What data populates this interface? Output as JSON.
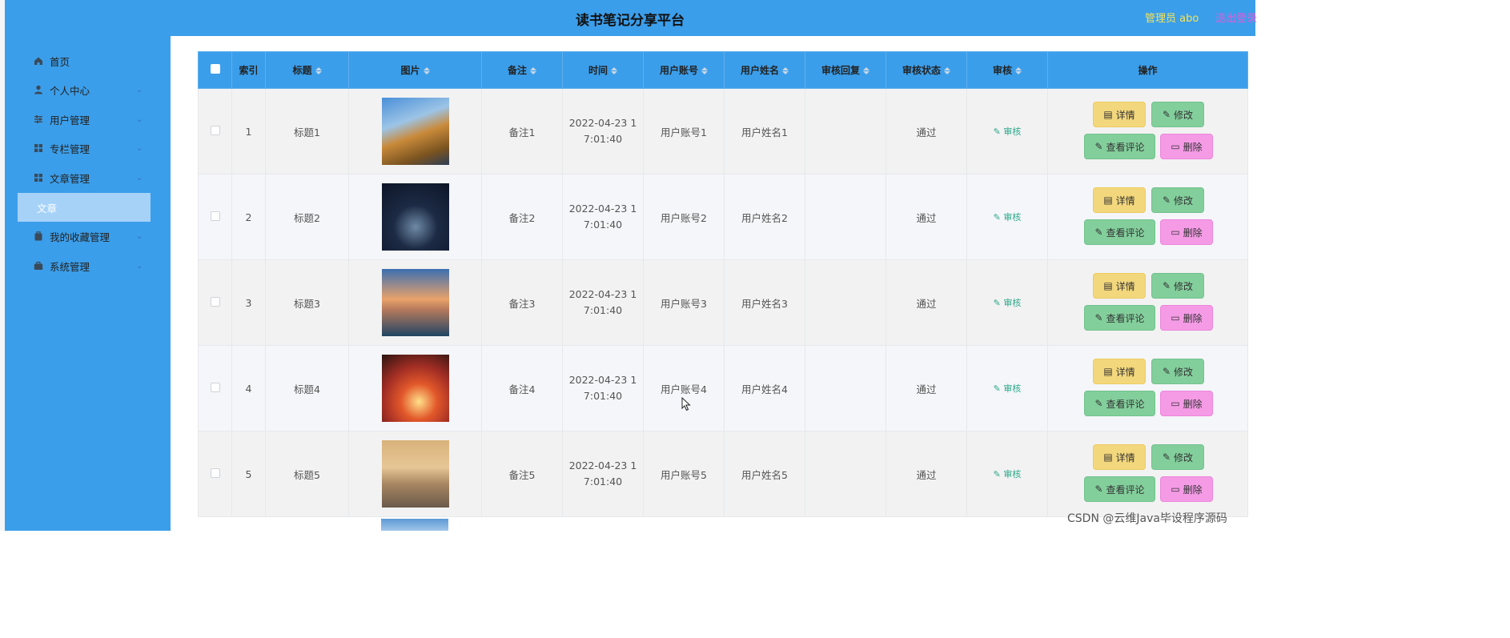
{
  "header": {
    "title": "读书笔记分享平台",
    "admin": "管理员 abo",
    "logout": "退出登录"
  },
  "sidebar": {
    "items": [
      {
        "label": "首页",
        "icon": "home-icon",
        "chevron": false
      },
      {
        "label": "个人中心",
        "icon": "user-icon",
        "chevron": true
      },
      {
        "label": "用户管理",
        "icon": "sliders-icon",
        "chevron": true
      },
      {
        "label": "专栏管理",
        "icon": "grid-icon",
        "chevron": true
      },
      {
        "label": "文章管理",
        "icon": "grid-icon",
        "chevron": true
      },
      {
        "label": "我的收藏管理",
        "icon": "bag-icon",
        "chevron": true
      },
      {
        "label": "系统管理",
        "icon": "briefcase-icon",
        "chevron": true
      }
    ],
    "active_sub": "文章"
  },
  "table": {
    "columns": [
      "索引",
      "标题",
      "图片",
      "备注",
      "时间",
      "用户账号",
      "用户姓名",
      "审核回复",
      "审核状态",
      "审核",
      "操作"
    ],
    "rows": [
      {
        "index": "1",
        "title": "标题1",
        "note": "备注1",
        "time1": "2022-04-23 1",
        "time2": "7:01:40",
        "account": "用户账号1",
        "name": "用户姓名1",
        "reply": "",
        "status": "通过",
        "audit": "审核"
      },
      {
        "index": "2",
        "title": "标题2",
        "note": "备注2",
        "time1": "2022-04-23 1",
        "time2": "7:01:40",
        "account": "用户账号2",
        "name": "用户姓名2",
        "reply": "",
        "status": "通过",
        "audit": "审核"
      },
      {
        "index": "3",
        "title": "标题3",
        "note": "备注3",
        "time1": "2022-04-23 1",
        "time2": "7:01:40",
        "account": "用户账号3",
        "name": "用户姓名3",
        "reply": "",
        "status": "通过",
        "audit": "审核"
      },
      {
        "index": "4",
        "title": "标题4",
        "note": "备注4",
        "time1": "2022-04-23 1",
        "time2": "7:01:40",
        "account": "用户账号4",
        "name": "用户姓名4",
        "reply": "",
        "status": "通过",
        "audit": "审核"
      },
      {
        "index": "5",
        "title": "标题5",
        "note": "备注5",
        "time1": "2022-04-23 1",
        "time2": "7:01:40",
        "account": "用户账号5",
        "name": "用户姓名5",
        "reply": "",
        "status": "通过",
        "audit": "审核"
      }
    ],
    "actions": {
      "detail": "详情",
      "edit": "修改",
      "comment": "查看评论",
      "delete": "删除"
    }
  },
  "watermark": "CSDN @云维Java毕设程序源码",
  "colors": {
    "primary": "#3b9eea",
    "detail": "#f3d77c",
    "edit": "#83cf9c",
    "delete": "#f59be6",
    "admin": "#f5e35a",
    "logout": "#e35ad9"
  }
}
